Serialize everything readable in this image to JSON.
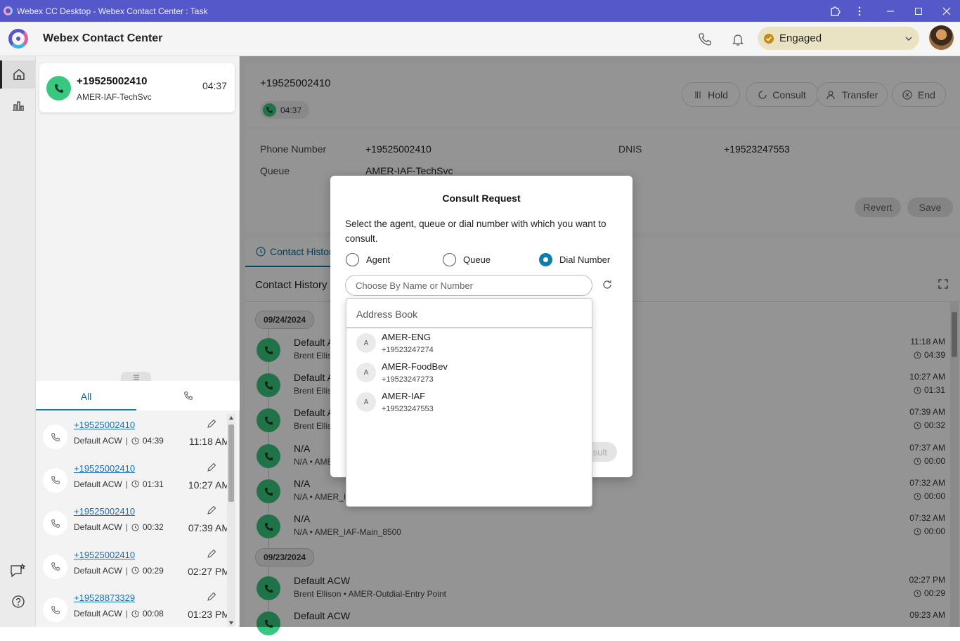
{
  "window": {
    "title": "Webex CC Desktop - Webex Contact Center : Task"
  },
  "header": {
    "app_name": "Webex Contact Center",
    "agent_state": "Engaged"
  },
  "task_card": {
    "number": "+19525002410",
    "queue": "AMER-IAF-TechSvc",
    "timer": "04:37"
  },
  "history_tabs": {
    "all": "All"
  },
  "history_items": [
    {
      "number": "+19525002410",
      "wrapup": "Default ACW",
      "duration": "04:39",
      "time": "11:18 AM"
    },
    {
      "number": "+19525002410",
      "wrapup": "Default ACW",
      "duration": "01:31",
      "time": "10:27 AM"
    },
    {
      "number": "+19525002410",
      "wrapup": "Default ACW",
      "duration": "00:32",
      "time": "07:39 AM"
    },
    {
      "number": "+19525002410",
      "wrapup": "Default ACW",
      "duration": "00:29",
      "time": "02:27 PM"
    },
    {
      "number": "+19528873329",
      "wrapup": "Default ACW",
      "duration": "00:08",
      "time": "01:23 PM"
    }
  ],
  "interaction": {
    "number": "+19525002410",
    "timer": "04:37",
    "controls": {
      "hold": "Hold",
      "consult": "Consult",
      "transfer": "Transfer",
      "end": "End"
    },
    "fields": {
      "phone_label": "Phone Number",
      "phone_value": "+19525002410",
      "dnis_label": "DNIS",
      "dnis_value": "+19523247553",
      "queue_label": "Queue",
      "queue_value": "AMER-IAF-TechSvc"
    },
    "revert": "Revert",
    "save": "Save"
  },
  "contact_history": {
    "tab": "Contact History",
    "title": "Contact History",
    "date1": "09/24/2024",
    "date2": "09/23/2024",
    "rows": [
      {
        "title": "Default AC",
        "sub": "Brent Ellison",
        "time": "11:18 AM",
        "dur": "04:39"
      },
      {
        "title": "Default AC",
        "sub": "Brent Ellison",
        "time": "10:27 AM",
        "dur": "01:31"
      },
      {
        "title": "Default AC",
        "sub": "Brent Ellison",
        "time": "07:39 AM",
        "dur": "00:32"
      },
      {
        "title": "N/A",
        "sub": "N/A • AMER_",
        "time": "07:37 AM",
        "dur": "00:00"
      },
      {
        "title": "N/A",
        "sub": "N/A • AMER_IAF",
        "time": "07:32 AM",
        "dur": "00:00"
      },
      {
        "title": "N/A",
        "sub": "N/A • AMER_IAF-Main_8500",
        "time": "07:32 AM",
        "dur": "00:00"
      },
      {
        "title": "Default ACW",
        "sub": "Brent Ellison • AMER-Outdial-Entry Point",
        "time": "02:27 PM",
        "dur": "00:29"
      },
      {
        "title": "Default ACW",
        "sub": "",
        "time": "09:23 AM",
        "dur": ""
      }
    ]
  },
  "consult_modal": {
    "title": "Consult Request",
    "description": "Select the agent, queue or dial number with which you want to consult.",
    "options": {
      "agent": "Agent",
      "queue": "Queue",
      "dial": "Dial Number"
    },
    "selected": "Dial Number",
    "search_placeholder": "Choose By Name or Number",
    "consult_button_partial": "sult",
    "address_book": {
      "header": "Address Book",
      "entries": [
        {
          "initial": "A",
          "name": "AMER-ENG",
          "number": "+19523247274"
        },
        {
          "initial": "A",
          "name": "AMER-FoodBev",
          "number": "+19523247273"
        },
        {
          "initial": "A",
          "name": "AMER-IAF",
          "number": "+19523247553"
        }
      ]
    }
  },
  "colors": {
    "titlebar": "#5558c9",
    "green": "#38c77f",
    "accent": "#0b7fab",
    "state_bg": "#e9e3c4"
  }
}
